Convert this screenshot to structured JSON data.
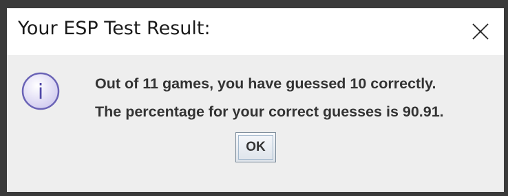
{
  "window": {
    "title": "Your ESP Test Result:"
  },
  "message": {
    "line1": "Out of 11 games, you have guessed 10 correctly.",
    "line2": "The percentage for your correct guesses is 90.91."
  },
  "buttons": {
    "ok_label": "OK"
  },
  "icons": {
    "info_icon": "information-icon",
    "info_glyph": "i",
    "close_icon": "close-icon"
  },
  "colors": {
    "info_icon_fill": "#dcd8f2",
    "info_icon_stroke": "#6a63b6",
    "info_icon_glyph": "#4f47a8"
  }
}
